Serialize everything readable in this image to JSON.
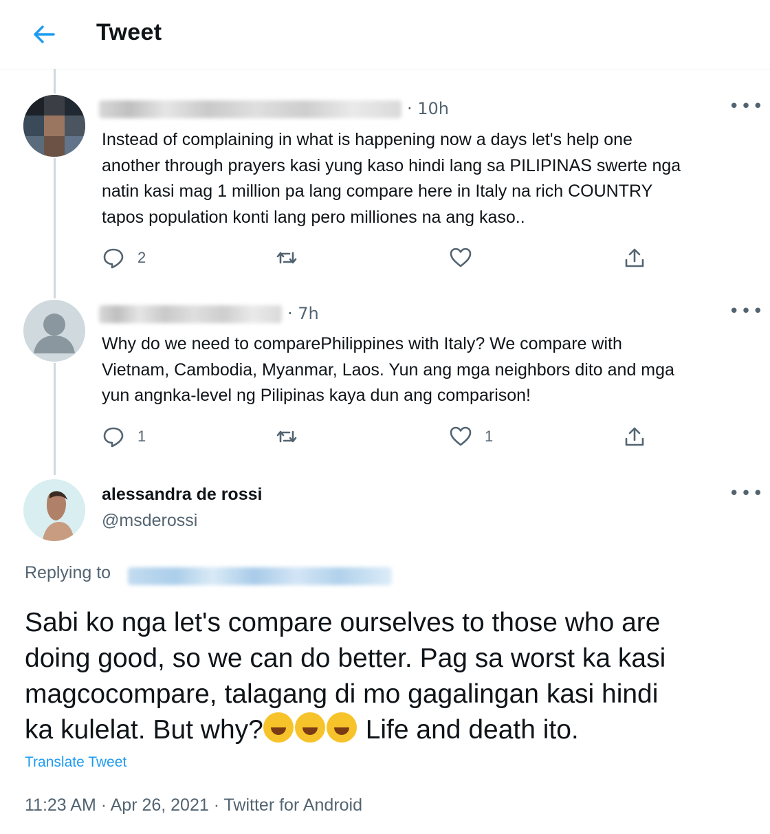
{
  "header": {
    "title": "Tweet"
  },
  "replies": [
    {
      "time": "· 10h",
      "text_lines": [
        "Instead of complaining in what is happening now a days let's help one",
        "another through prayers kasi yung kaso hindi lang sa PILIPINAS swerte nga",
        "natin kasi mag 1 million pa lang compare here in Italy na rich COUNTRY",
        "tapos population konti lang pero milliones na ang kaso.."
      ],
      "reply_count": "2",
      "like_count": "",
      "more": "•••"
    },
    {
      "time": "· 7h",
      "text_lines": [
        "Why do we need to comparePhilippines with Italy? We compare with",
        "Vietnam, Cambodia, Myanmar, Laos. Yun ang mga neighbors dito and mga",
        "yun angnka-level ng Pilipinas kaya dun ang comparison!"
      ],
      "reply_count": "1",
      "like_count": "1",
      "more": "•••"
    }
  ],
  "main_tweet": {
    "name": "alessandra de rossi",
    "handle": "@msderossi",
    "replying_to": "Replying to",
    "text_lines": [
      "Sabi ko nga let's compare ourselves to those who are",
      "doing good, so we can do better. Pag sa worst ka kasi",
      "magcocompare, talagang di mo gagalingan kasi hindi"
    ],
    "last_line_start": "ka kulelat. But why?",
    "last_line_end": " Life and death ito.",
    "translate": "Translate Tweet",
    "meta": "11:23 AM · Apr 26, 2021 · Twitter for Android",
    "more": "•••"
  },
  "colors": {
    "accent": "#1d9bf0",
    "muted": "#536471",
    "line": "#cfd9de"
  }
}
